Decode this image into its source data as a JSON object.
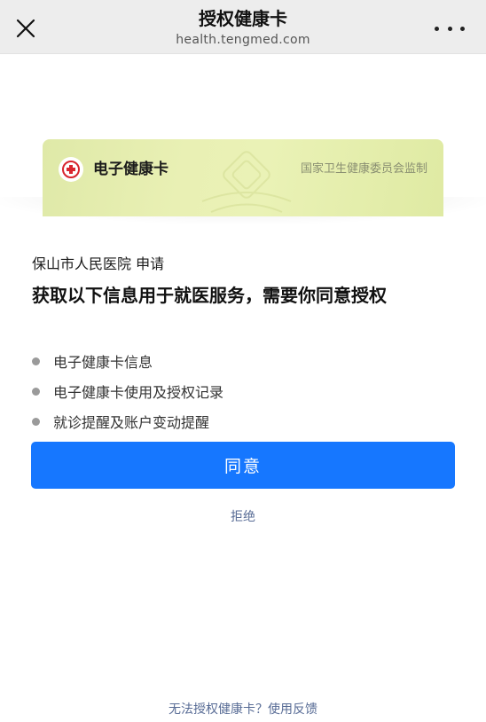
{
  "header": {
    "title": "授权健康卡",
    "subtitle": "health.tengmed.com",
    "close_icon": "close-icon",
    "more_icon": "more-dots-icon"
  },
  "card": {
    "name": "电子健康卡",
    "supervisor": "国家卫生健康委员会监制",
    "logo_icon": "health-card-logo-icon",
    "colors": {
      "card_bg": "#e6efb0",
      "logo_red": "#d8262e"
    }
  },
  "applicant": "保山市人民医院  申请",
  "heading": "获取以下信息用于就医服务，需要你同意授权",
  "permissions": [
    "电子健康卡信息",
    "电子健康卡使用及授权记录",
    "就诊提醒及账户变动提醒"
  ],
  "actions": {
    "agree_label": "同意",
    "reject_label": "拒绝"
  },
  "footer": {
    "feedback_text": "无法授权健康卡？使用反馈"
  },
  "colors": {
    "accent": "#1677ff",
    "link": "#576b95",
    "topbar_bg": "#ededed"
  }
}
